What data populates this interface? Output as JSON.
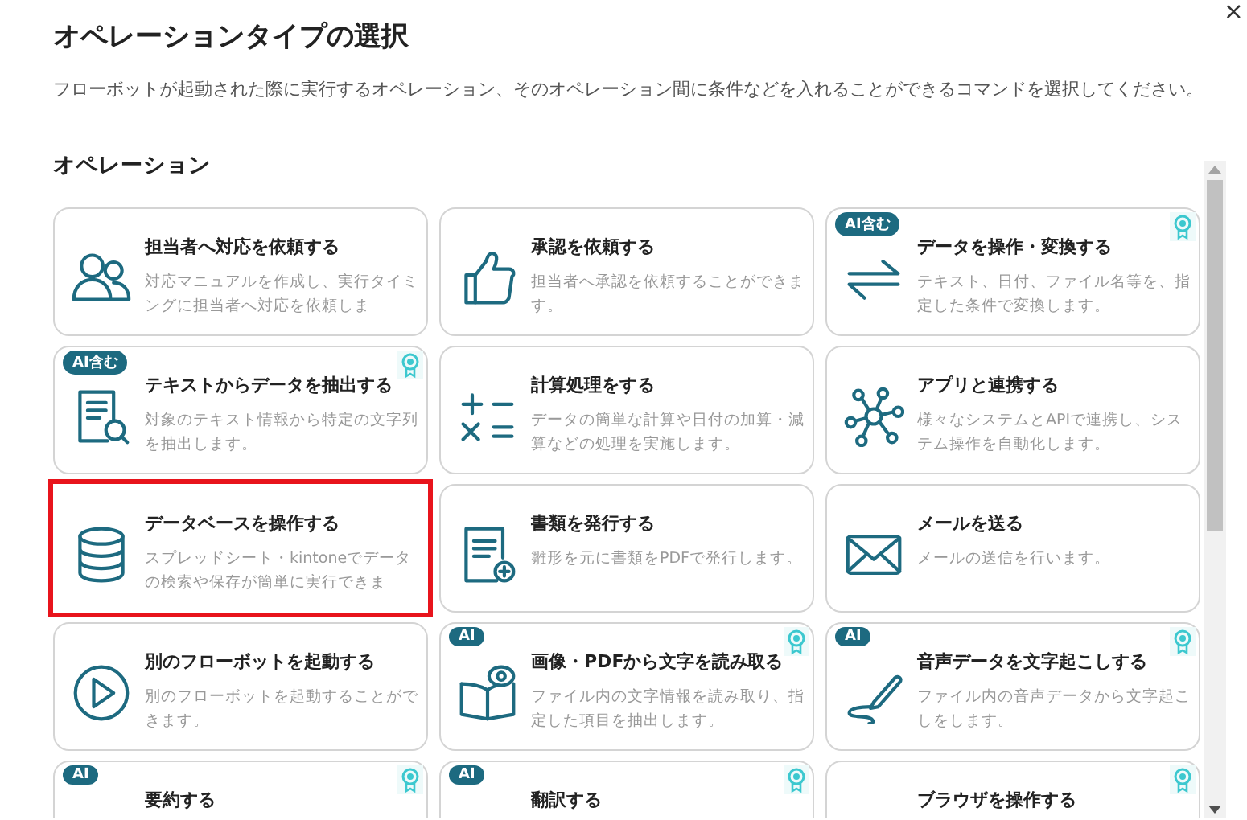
{
  "dialog": {
    "title": "オペレーションタイプの選択",
    "close": "×",
    "description": "フローボットが起動された際に実行するオペレーション、そのオペレーション間に条件などを入れることができるコマンドを選択してください。"
  },
  "section": {
    "title": "オペレーション"
  },
  "cards": [
    {
      "title": "担当者へ対応を依頼する",
      "description": "対応マニュアルを作成し、実行タイミングに担当者へ対応を依頼しま",
      "kind": "people",
      "award": false,
      "highlighted": false
    },
    {
      "title": "承認を依頼する",
      "description": "担当者へ承認を依頼することができます。",
      "kind": "thumb",
      "award": false,
      "highlighted": false
    },
    {
      "title": "データを操作・変換する",
      "description": "テキスト、日付、ファイル名等を、指定した条件で変換します。",
      "kind": "arrows",
      "badge": "AI含む",
      "award": true,
      "highlighted": false
    },
    {
      "title": "テキストからデータを抽出する",
      "description": "対象のテキスト情報から特定の文字列を抽出します。",
      "kind": "docsearch",
      "badge": "AI含む",
      "award": true,
      "highlighted": false
    },
    {
      "title": "計算処理をする",
      "description": "データの簡単な計算や日付の加算・減算などの処理を実施します。",
      "kind": "calc",
      "award": false,
      "highlighted": false
    },
    {
      "title": "アプリと連携する",
      "description": "様々なシステムとAPIで連携し、システム操作を自動化します。",
      "kind": "network",
      "award": false,
      "highlighted": false
    },
    {
      "title": "データベースを操作する",
      "description": "スプレッドシート・kintoneでデータの検索や保存が簡単に実行できま",
      "kind": "database",
      "award": false,
      "highlighted": true
    },
    {
      "title": "書類を発行する",
      "description": "雛形を元に書類をPDFで発行します。",
      "kind": "docplus",
      "award": false,
      "highlighted": false
    },
    {
      "title": "メールを送る",
      "description": "メールの送信を行います。",
      "kind": "mail",
      "award": false,
      "highlighted": false
    },
    {
      "title": "別のフローボットを起動する",
      "description": "別のフローボットを起動することができます。",
      "kind": "play",
      "award": false,
      "highlighted": false
    },
    {
      "title": "画像・PDFから文字を読み取る",
      "description": "ファイル内の文字情報を読み取り、指定した項目を抽出します。",
      "kind": "book",
      "badge": "AI",
      "award": true,
      "highlighted": false
    },
    {
      "title": "音声データを文字起こしする",
      "description": "ファイル内の音声データから文字起こしをします。",
      "kind": "pen",
      "badge": "AI",
      "award": true,
      "highlighted": false
    },
    {
      "title": "要約する",
      "badge": "AI",
      "award": true,
      "highlighted": false
    },
    {
      "title": "翻訳する",
      "badge": "AI",
      "award": true,
      "highlighted": false
    },
    {
      "title": "ブラウザを操作する",
      "award": true,
      "highlighted": false
    }
  ]
}
